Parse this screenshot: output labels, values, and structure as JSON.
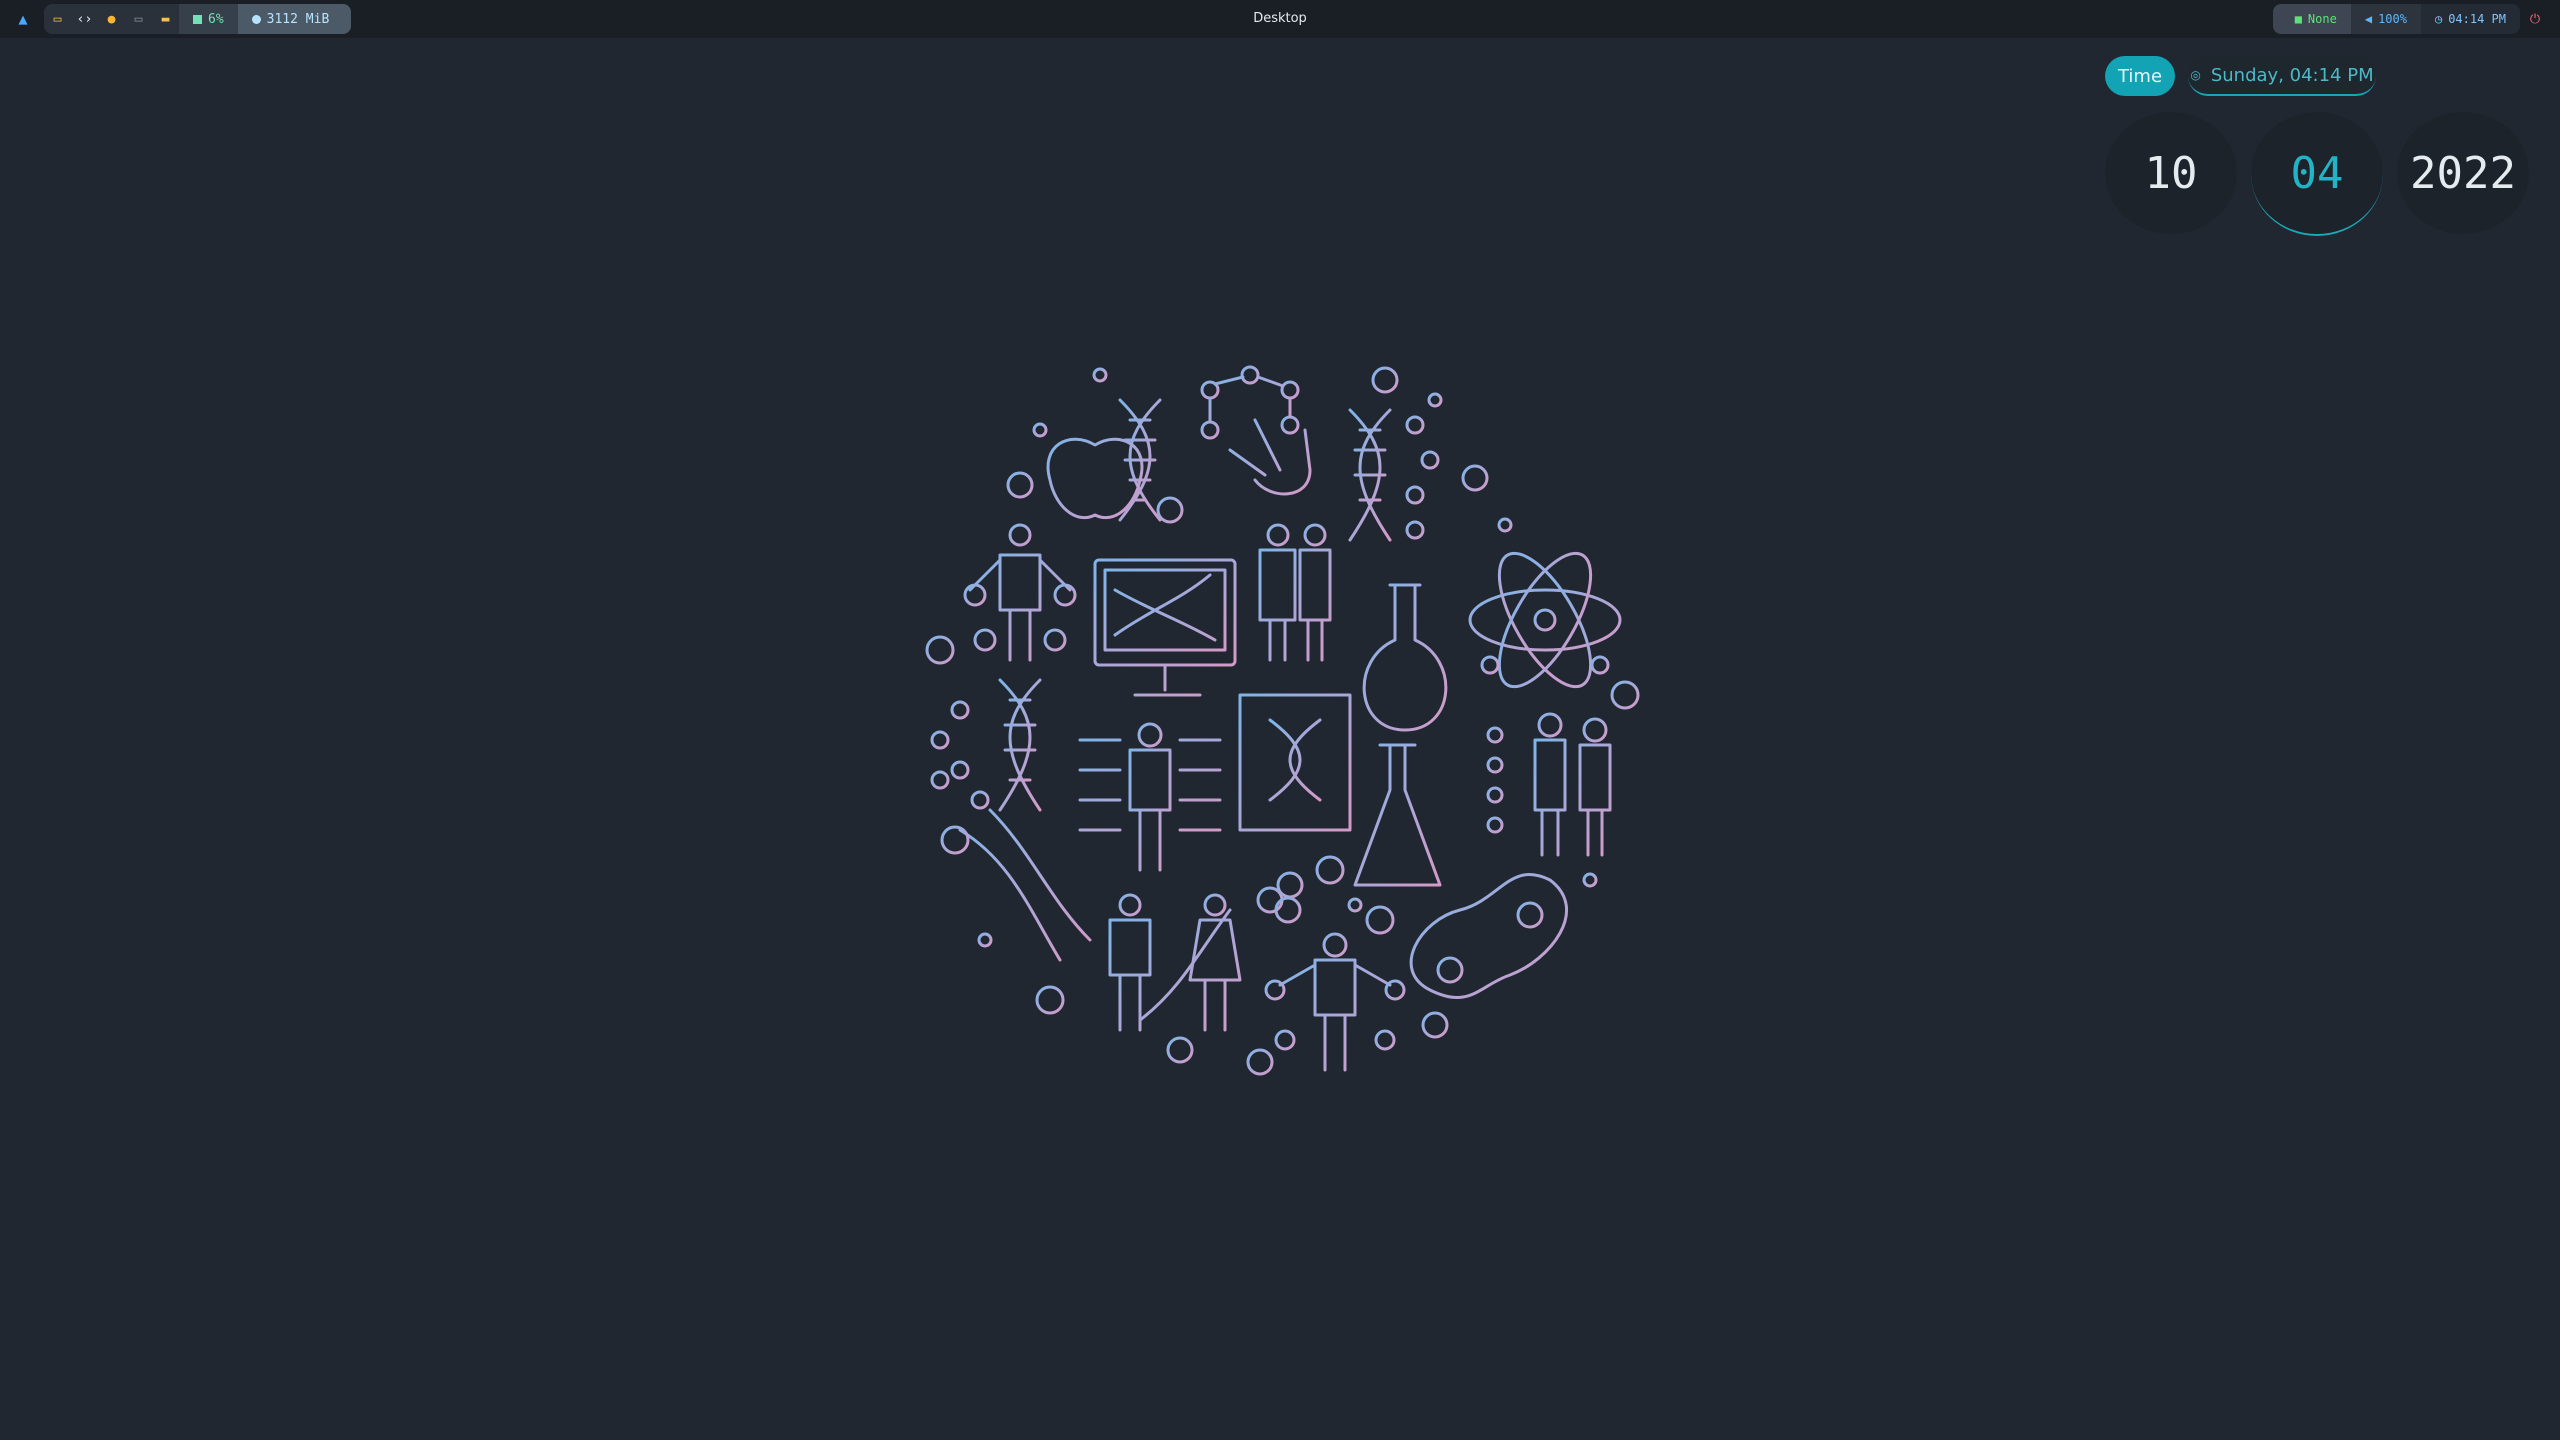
{
  "bar": {
    "launcher_icon": "arch-logo-icon",
    "workspaces": [
      {
        "icon": "terminal-icon",
        "color": "#f2c14e"
      },
      {
        "icon": "code-icon",
        "color": "#f0f2f5"
      },
      {
        "icon": "firefox-icon",
        "color": "#f7b733"
      },
      {
        "icon": "game-icon",
        "color": "#8a8f97"
      },
      {
        "icon": "folder-icon",
        "color": "#f2c14e"
      }
    ],
    "cpu": "6%",
    "memory": "3112 MiB",
    "title": "Desktop",
    "network": "None",
    "volume": "100%",
    "clock": "04:14 PM"
  },
  "widget": {
    "tab_label": "Time",
    "date_text": "Sunday, 04:14 PM",
    "day": "10",
    "month": "04",
    "year": "2022"
  },
  "wallpaper": {
    "description_icon": "science-icons-wallpaper",
    "colors": {
      "start": "#7fb4e8",
      "end": "#d39ac8"
    }
  }
}
